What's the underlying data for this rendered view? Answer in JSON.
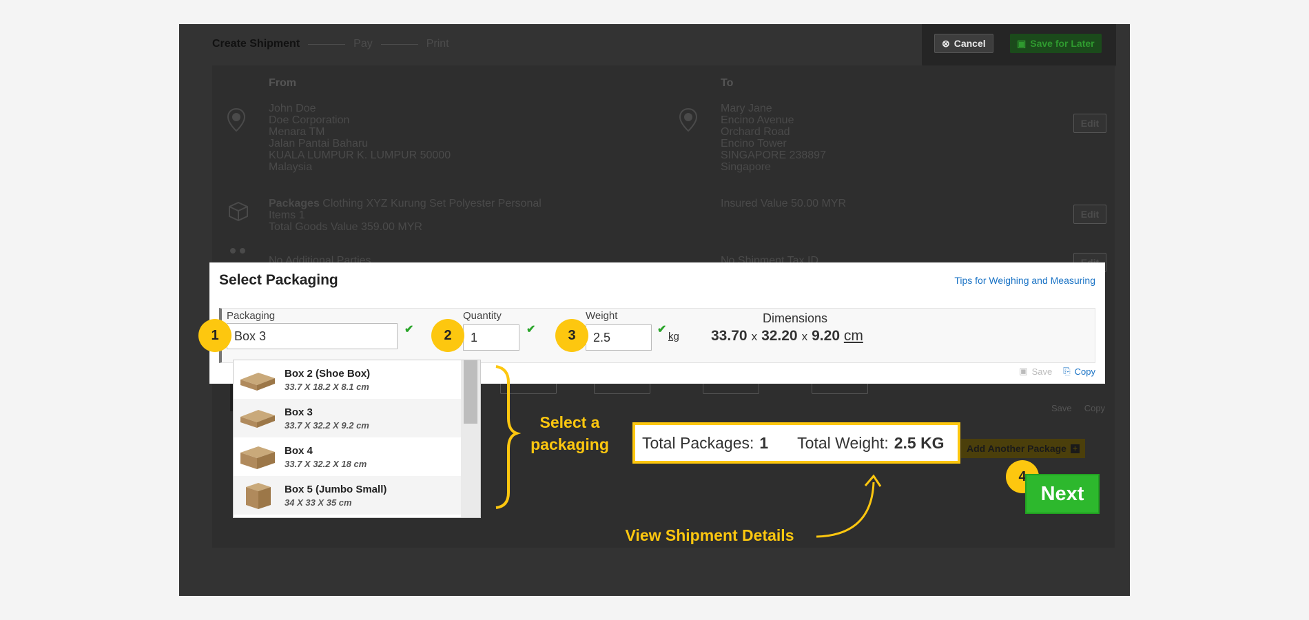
{
  "steps": {
    "create": "Create Shipment",
    "pay": "Pay",
    "print": "Print"
  },
  "top_actions": {
    "cancel": "Cancel",
    "save_later": "Save for Later"
  },
  "from": {
    "heading": "From",
    "lines": [
      "John Doe",
      "Doe Corporation",
      "Menara TM",
      "Jalan Pantai Baharu",
      "KUALA LUMPUR K. LUMPUR 50000",
      "Malaysia"
    ]
  },
  "to": {
    "heading": "To",
    "lines": [
      "Mary Jane",
      "Encino Avenue",
      "Orchard Road",
      "Encino Tower",
      "SINGAPORE 238897",
      "Singapore"
    ]
  },
  "packages_summary": {
    "label": "Packages",
    "desc": "Clothing XYZ Kurung Set Polyester Personal",
    "items": "Items      1",
    "value": "Total Goods Value 359.00 MYR",
    "insured": "Insured Value 50.00 MYR"
  },
  "additional": {
    "left": "No Additional Parties",
    "right": "No Shipment Tax ID"
  },
  "edit_label": "Edit",
  "add_another": "Add Another Package",
  "modal": {
    "title": "Select Packaging",
    "tips": "Tips for Weighing and Measuring",
    "packaging_label": "Packaging",
    "packaging_value": "Box 3",
    "quantity_label": "Quantity",
    "quantity_value": "1",
    "weight_label": "Weight",
    "weight_value": "2.5",
    "weight_unit": "kg",
    "dimensions_label": "Dimensions",
    "dim_l": "33.70",
    "dim_w": "32.20",
    "dim_h": "9.20",
    "dim_sep": "x",
    "dim_unit": "cm",
    "save": "Save",
    "copy": "Copy"
  },
  "dropdown": [
    {
      "name": "Box 2 (Shoe Box)",
      "dims": "33.7 X 18.2 X 8.1 cm"
    },
    {
      "name": "Box 3",
      "dims": "33.7 X 32.2 X 9.2 cm"
    },
    {
      "name": "Box 4",
      "dims": "33.7 X 32.2 X 18 cm"
    },
    {
      "name": "Box 5 (Jumbo Small)",
      "dims": "34 X 33 X 35 cm"
    }
  ],
  "ghost": {
    "save": "Save",
    "copy": "Copy"
  },
  "callouts": {
    "b1": "1",
    "b2": "2",
    "b3": "3",
    "b4": "4",
    "select_a": "Select a",
    "packaging": "packaging",
    "view_details": "View Shipment Details"
  },
  "summary": {
    "packages_label": "Total Packages:",
    "packages_value": "1",
    "weight_label": "Total Weight:",
    "weight_value": "2.5 KG"
  },
  "next": "Next",
  "colors": {
    "accent_yellow": "#fdc70f",
    "next_green": "#2db82d",
    "link_blue": "#1a73c5",
    "backdrop": "#333333"
  }
}
